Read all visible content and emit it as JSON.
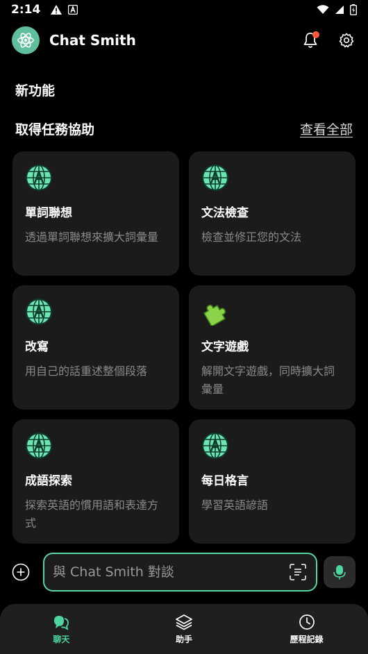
{
  "status_bar": {
    "time": "2:14"
  },
  "header": {
    "title": "Chat Smith"
  },
  "section_new": {
    "title": "新功能"
  },
  "section_tasks": {
    "title": "取得任務協助",
    "view_all": "查看全部"
  },
  "cards": [
    {
      "title": "單詞聯想",
      "desc": "透過單詞聯想來擴大詞彙量",
      "icon": "globe-icon"
    },
    {
      "title": "文法檢查",
      "desc": "檢查並修正您的文法",
      "icon": "globe-icon"
    },
    {
      "title": "改寫",
      "desc": "用自己的話重述整個段落",
      "icon": "globe-icon"
    },
    {
      "title": "文字遊戲",
      "desc": "解開文字遊戲，同時擴大詞彙量",
      "icon": "puzzle-icon"
    },
    {
      "title": "成語探索",
      "desc": "探索英語的慣用語和表達方式",
      "icon": "globe-icon"
    },
    {
      "title": "每日格言",
      "desc": "學習英語諺語",
      "icon": "globe-icon"
    }
  ],
  "input": {
    "placeholder": "與 Chat Smith 對談"
  },
  "nav": [
    {
      "label": "聊天",
      "active": true
    },
    {
      "label": "助手",
      "active": false
    },
    {
      "label": "歷程記錄",
      "active": false
    }
  ],
  "colors": {
    "accent": "#4fd6a0",
    "card_bg": "#1b1b1b",
    "notification": "#ff5a3c"
  }
}
